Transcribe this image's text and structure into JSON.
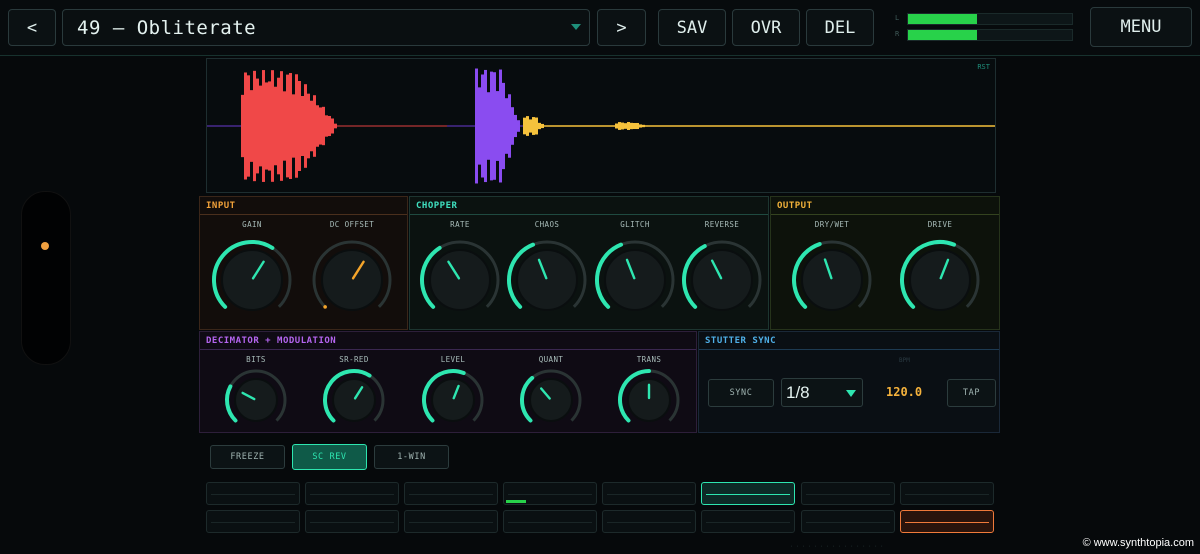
{
  "topbar": {
    "prev_label": "<",
    "preset_name": "49 – Obliterate",
    "next_label": ">",
    "save_label": "SAV",
    "overwrite_label": "OVR",
    "delete_label": "DEL",
    "menu_label": "MENU",
    "meter_labels": [
      "L",
      "R"
    ],
    "meter_levels": [
      0.42,
      0.42
    ]
  },
  "waveform": {
    "tag": "RST",
    "colors": {
      "input": "#f04848",
      "chopper": "#8a4cf0",
      "output": "#f5c23c"
    }
  },
  "sections": {
    "input": {
      "title": "INPUT",
      "knobs": [
        {
          "label": "GAIN",
          "value": 0.62,
          "color": "#2ee6b0"
        },
        {
          "label": "DC OFFSET",
          "value": 0.62,
          "color": "#f5a52a",
          "unarc": true
        }
      ]
    },
    "chopper": {
      "title": "CHOPPER",
      "knobs": [
        {
          "label": "RATE",
          "value": 0.38,
          "color": "#2ee6b0"
        },
        {
          "label": "CHAOS",
          "value": 0.42,
          "color": "#2ee6b0"
        },
        {
          "label": "GLITCH",
          "value": 0.42,
          "color": "#2ee6b0"
        },
        {
          "label": "REVERSE",
          "value": 0.4,
          "color": "#2ee6b0"
        }
      ]
    },
    "output": {
      "title": "OUTPUT",
      "knobs": [
        {
          "label": "DRY/WET",
          "value": 0.43,
          "color": "#2ee6b0"
        },
        {
          "label": "DRIVE",
          "value": 0.58,
          "color": "#2ee6b0"
        }
      ]
    },
    "decimator": {
      "title": "DECIMATOR + MODULATION",
      "knobs": [
        {
          "label": "BITS",
          "value": 0.27,
          "color": "#2ee6b0"
        },
        {
          "label": "SR-RED",
          "value": 0.62,
          "color": "#2ee6b0"
        },
        {
          "label": "LEVEL",
          "value": 0.58,
          "color": "#2ee6b0"
        },
        {
          "label": "QUANT",
          "value": 0.35,
          "color": "#2ee6b0"
        },
        {
          "label": "TRANS",
          "value": 0.5,
          "color": "#2ee6b0"
        }
      ]
    },
    "stutter": {
      "title": "STUTTER SYNC",
      "bpm_label": "BPM",
      "sync_label": "SYNC",
      "division": "1/8",
      "bpm": "120.0",
      "tap_label": "TAP"
    }
  },
  "controls": {
    "freeze_label": "FREEZE",
    "screv_label": "SC REV",
    "win_label": "1-WIN"
  },
  "watermark": "© www.synthtopia.com"
}
